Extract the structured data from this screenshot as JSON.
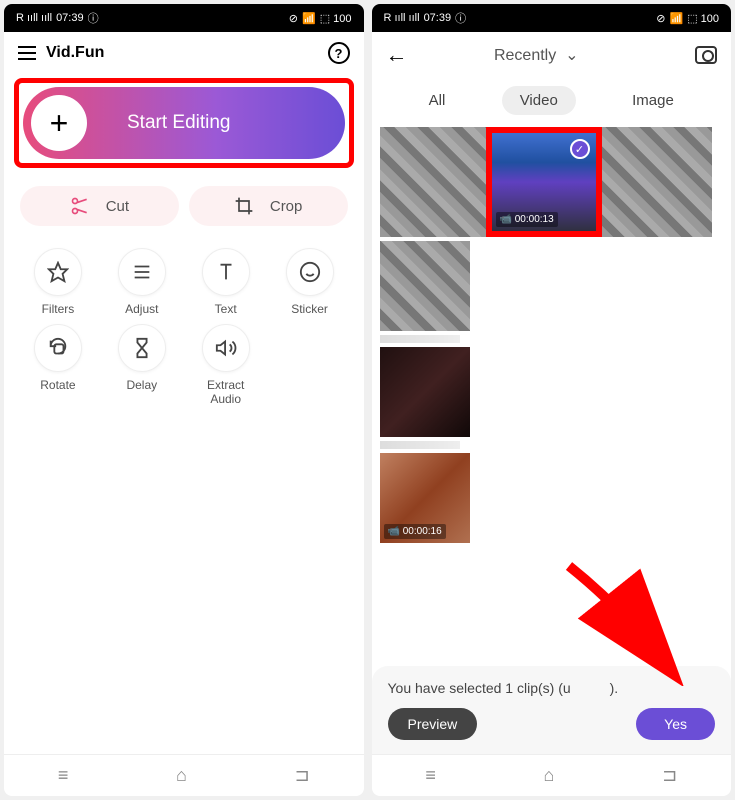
{
  "statusBar": {
    "time": "07:39",
    "signal": "R ııll ııll",
    "batteryIcon": "100"
  },
  "left": {
    "appTitle": "Vid.Fun",
    "startEditing": "Start Editing",
    "tools": {
      "cut": "Cut",
      "crop": "Crop"
    },
    "grid": [
      {
        "name": "Filters"
      },
      {
        "name": "Adjust"
      },
      {
        "name": "Text"
      },
      {
        "name": "Sticker"
      },
      {
        "name": "Rotate"
      },
      {
        "name": "Delay"
      },
      {
        "name": "Extract\nAudio"
      }
    ]
  },
  "right": {
    "title": "Recently",
    "tabs": {
      "all": "All",
      "video": "Video",
      "image": "Image"
    },
    "selectedDuration": "00:00:13",
    "sheet": {
      "text": "You have selected 1 clip(s) (u",
      "text2": ").",
      "preview": "Preview",
      "yes": "Yes"
    }
  }
}
